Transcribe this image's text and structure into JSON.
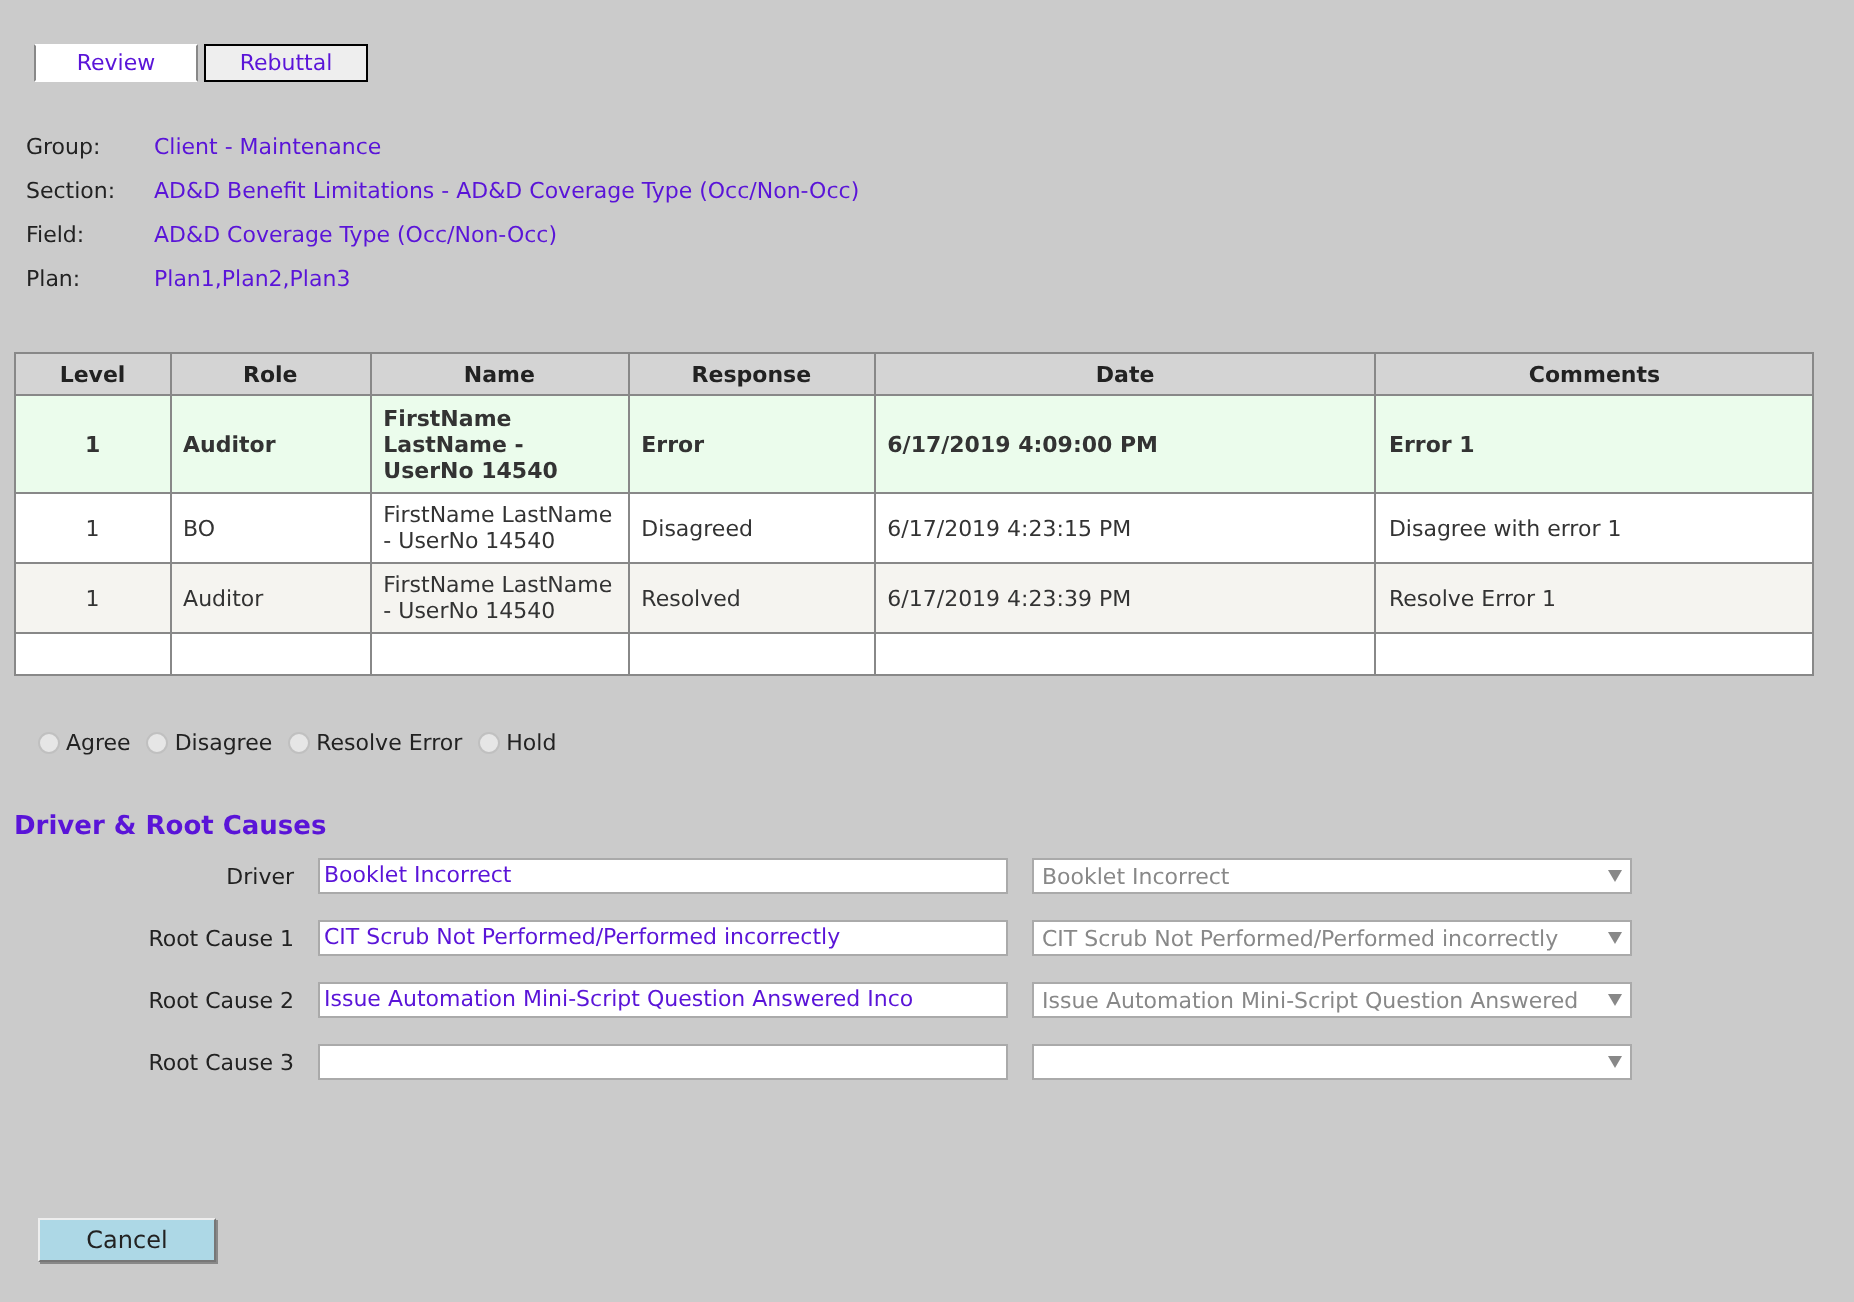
{
  "tabs": [
    {
      "label": "Review",
      "selected": true
    },
    {
      "label": "Rebuttal",
      "selected": false
    }
  ],
  "info": [
    {
      "label": "Group:",
      "value": "Client - Maintenance"
    },
    {
      "label": "Section:",
      "value": "AD&D Benefit Limitations - AD&D Coverage Type (Occ/Non-Occ)"
    },
    {
      "label": "Field:",
      "value": "AD&D Coverage Type (Occ/Non-Occ)"
    },
    {
      "label": "Plan:",
      "value": "Plan1,Plan2,Plan3"
    }
  ],
  "table": {
    "columns": [
      "Level",
      "Role",
      "Name",
      "Response",
      "Date",
      "Comments"
    ],
    "rows": [
      {
        "highlighted": true,
        "cells": [
          "1",
          "Auditor",
          "FirstName LastName - UserNo 14540",
          "Error",
          "6/17/2019 4:09:00 PM",
          "Error 1"
        ]
      },
      {
        "highlighted": false,
        "cells": [
          "1",
          "BO",
          "FirstName LastName - UserNo 14540",
          "Disagreed",
          "6/17/2019 4:23:15 PM",
          "Disagree with error 1"
        ]
      },
      {
        "highlighted": false,
        "cells": [
          "1",
          "Auditor",
          "FirstName LastName - UserNo 14540",
          "Resolved",
          "6/17/2019 4:23:39 PM",
          "Resolve Error 1"
        ]
      }
    ]
  },
  "responses": [
    {
      "label": "Agree",
      "selected": false
    },
    {
      "label": "Disagree",
      "selected": false
    },
    {
      "label": "Resolve Error",
      "selected": false
    },
    {
      "label": "Hold",
      "selected": false
    }
  ],
  "driver_section": {
    "title": "Driver & Root Causes",
    "rows": [
      {
        "label": "Driver",
        "value": "Booklet Incorrect",
        "selection": "Booklet Incorrect"
      },
      {
        "label": "Root Cause 1",
        "value": "CIT Scrub Not Performed/Performed incorrectly",
        "selection": "CIT Scrub Not Performed/Performed incorrectly"
      },
      {
        "label": "Root Cause 2",
        "value": "Issue Automation Mini-Script Question Answered Inco",
        "selection": "Issue Automation Mini-Script Question Answered"
      },
      {
        "label": "Root Cause 3"
      }
    ]
  },
  "buttons": [
    "Cancel"
  ]
}
